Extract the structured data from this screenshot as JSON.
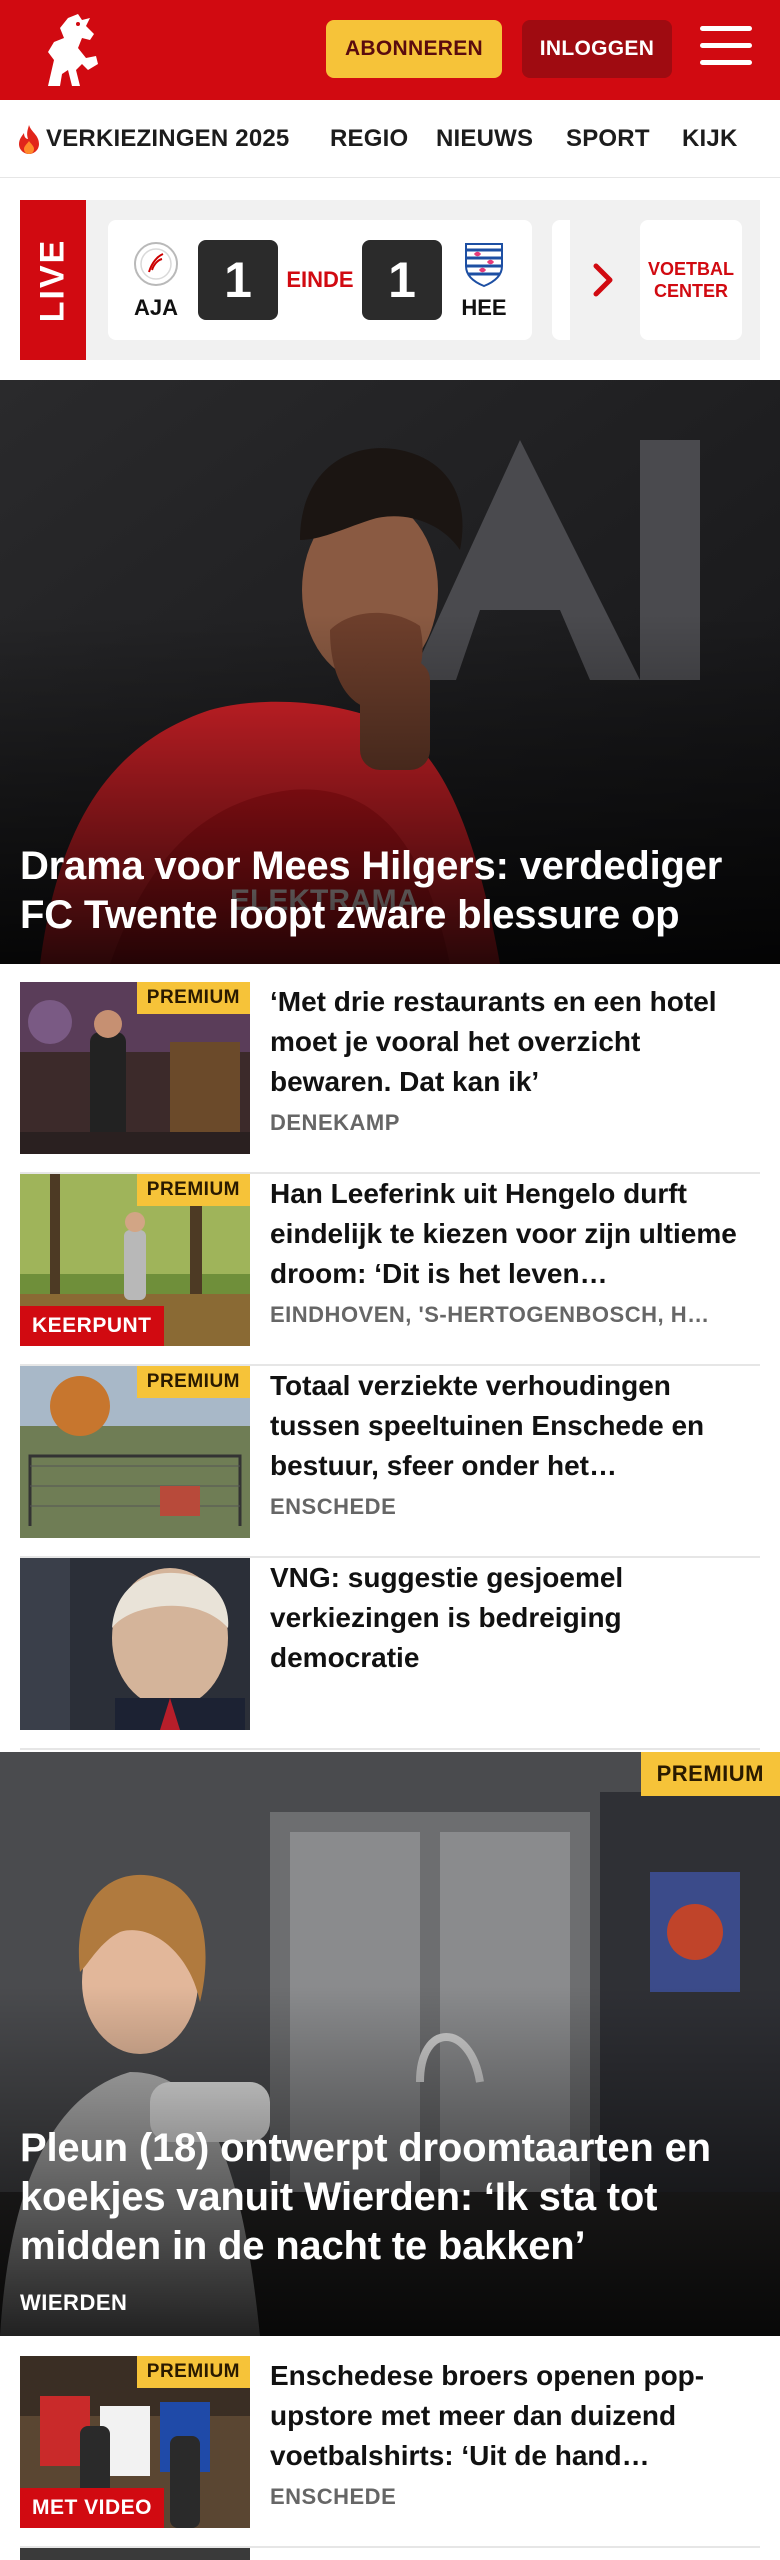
{
  "header": {
    "subscribe_label": "ABONNEREN",
    "login_label": "INLOGGEN",
    "logo_icon": "tubantia-horse-logo",
    "menu_icon": "hamburger-menu-icon",
    "brand_color": "#d10a11",
    "accent_color": "#f6c339"
  },
  "nav": {
    "items": [
      {
        "label": "VERKIEZINGEN 2025",
        "icon": "flame-icon"
      },
      {
        "label": "REGIO"
      },
      {
        "label": "NIEUWS"
      },
      {
        "label": "SPORT"
      },
      {
        "label": "KIJK"
      }
    ]
  },
  "live": {
    "tag": "LIVE",
    "match": {
      "home_code": "AJA",
      "home_score": "1",
      "status": "EINDE",
      "away_code": "HEE",
      "away_score": "1"
    },
    "voetbal_center_label": "VOETBAL CENTER"
  },
  "hero": {
    "title": "Drama voor Mees Hilgers: verdediger FC Twente loopt zware blessure op"
  },
  "articles": [
    {
      "premium": "PREMIUM",
      "title": "‘Met drie restaurants en een hotel moet je vooral het overzicht bewaren. Dat kan ik’",
      "location": "DENEKAMP"
    },
    {
      "premium": "PREMIUM",
      "label": "KEERPUNT",
      "title": "Han Leeferink uit Hengelo durft eindelijk te kiezen voor zijn ultieme droom: ‘Dit is het leven…",
      "location": "EINDHOVEN, 'S-HERTOGENBOSCH, H…"
    },
    {
      "premium": "PREMIUM",
      "title": "Totaal verziekte verhoudingen tussen speeltuinen Enschede en bestuur, sfeer onder het…",
      "location": "ENSCHEDE"
    },
    {
      "title": "VNG: suggestie gesjoemel verkiezingen is bedreiging democratie"
    }
  ],
  "feature": {
    "premium": "PREMIUM",
    "title": "Pleun (18) ontwerpt droomtaarten en koekjes vanuit Wierden: ‘Ik sta tot midden in de nacht te bakken’",
    "location": "WIERDEN"
  },
  "articles2": [
    {
      "premium": "PREMIUM",
      "label": "MET VIDEO",
      "title": "Enschedese broers openen pop-upstore met meer dan duizend voetbalshirts: ‘Uit de hand…",
      "location": "ENSCHEDE"
    }
  ]
}
